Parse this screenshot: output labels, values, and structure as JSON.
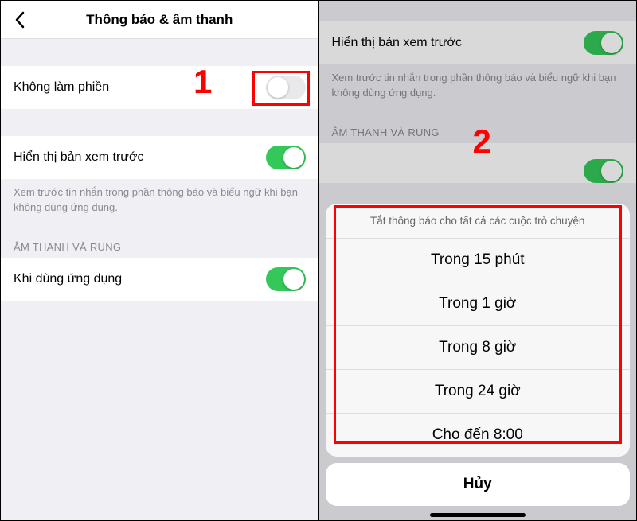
{
  "annotations": {
    "step1": "1",
    "step2": "2"
  },
  "left": {
    "header_title": "Thông báo & âm thanh",
    "dnd_label": "Không làm phiền",
    "preview_label": "Hiển thị bản xem trước",
    "preview_desc": "Xem trước tin nhắn trong phần thông báo và biểu ngữ khi bạn không dùng ứng dụng.",
    "section_sound": "ÂM THANH VÀ RUNG",
    "in_app_label": "Khi dùng ứng dụng"
  },
  "right": {
    "preview_label": "Hiển thị bản xem trước",
    "preview_desc": "Xem trước tin nhắn trong phần thông báo và biểu ngữ khi bạn không dùng ứng dụng.",
    "section_sound": "ÂM THANH VÀ RUNG",
    "sheet_title": "Tắt thông báo cho tất cả các cuộc trò chuyện",
    "options": {
      "o1": "Trong 15 phút",
      "o2": "Trong 1 giờ",
      "o3": "Trong 8 giờ",
      "o4": "Trong 24 giờ",
      "o5": "Cho đến 8:00"
    },
    "cancel": "Hủy"
  }
}
